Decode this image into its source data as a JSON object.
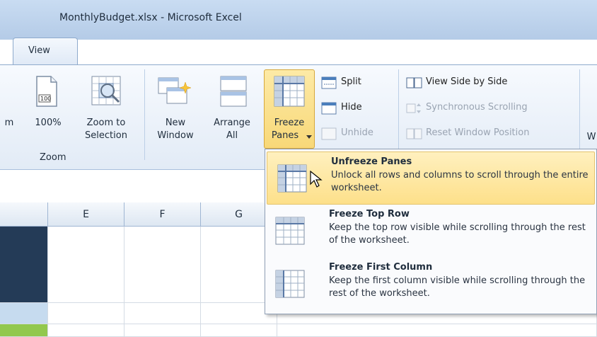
{
  "window": {
    "title": "MonthlyBudget.xlsx  -  Microsoft Excel"
  },
  "tabs": {
    "active": "View"
  },
  "ribbon": {
    "zoom_group": {
      "partial_label": "m",
      "btn_100": "100%",
      "zoom_to_selection_line1": "Zoom to",
      "zoom_to_selection_line2": "Selection",
      "group_label": "Zoom"
    },
    "window_group": {
      "new_window_line1": "New",
      "new_window_line2": "Window",
      "arrange_all_line1": "Arrange",
      "arrange_all_line2": "All",
      "freeze_panes_line1": "Freeze",
      "freeze_panes_line2": "Panes",
      "split": "Split",
      "hide": "Hide",
      "unhide": "Unhide",
      "view_side_by_side": "View Side by Side",
      "synchronous_scrolling": "Synchronous Scrolling",
      "reset_window_position": "Reset Window Position",
      "partial_right": "W"
    }
  },
  "grid": {
    "columns": [
      "E",
      "F",
      "G"
    ]
  },
  "freeze_menu": {
    "items": [
      {
        "title": "Unfreeze Panes",
        "desc": "Unlock all rows and columns to scroll through the entire worksheet."
      },
      {
        "title": "Freeze Top Row",
        "desc": "Keep the top row visible while scrolling through the rest of the worksheet."
      },
      {
        "title": "Freeze First Column",
        "desc": "Keep the first column visible while scrolling through the rest of the worksheet."
      }
    ]
  },
  "colors": {
    "header_dark_blue": "#243b57",
    "light_blue_cell": "#c6dbef",
    "green_cell": "#92c84d",
    "highlight": "#fde08a"
  }
}
